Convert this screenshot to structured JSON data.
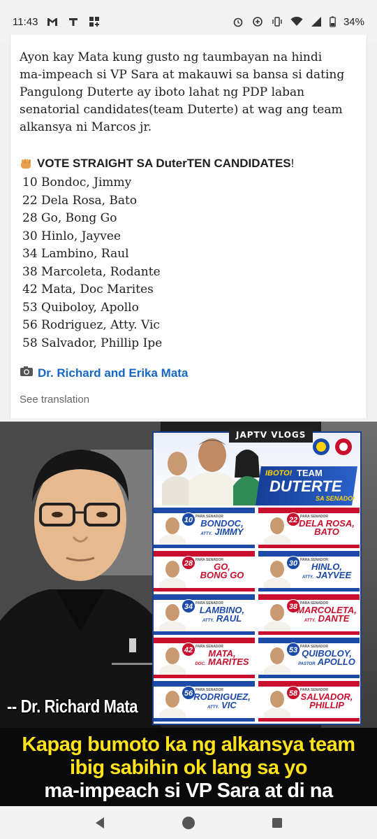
{
  "status_bar": {
    "time": "11:43",
    "battery": "34%",
    "icons": [
      "gmail-icon",
      "tmobile-icon",
      "apps-grid-icon",
      "alarm-icon",
      "data-saver-icon",
      "vibrate-icon",
      "wifi-icon",
      "signal-icon",
      "battery-icon"
    ]
  },
  "post": {
    "intro": "Ayon kay Mata kung gusto ng taumbayan na hindi ma-impeach si VP Sara at makauwi sa bansa si dating Pangulong Duterte ay iboto lahat ng PDP laban senatorial candidates(team Duterte) at wag ang team alkansya ni Marcos jr.",
    "vote_heading": "VOTE STRAIGHT SA DuterTEN CANDIDATES",
    "vote_heading_end": "!",
    "candidates": [
      "10 Bondoc, Jimmy",
      "22 Dela Rosa, Bato",
      "28 Go, Bong Go",
      "30 Hinlo, Jayvee",
      "34 Lambino, Raul",
      "38 Marcoleta, Rodante",
      "42 Mata, Doc Marites",
      "53 Quiboloy, Apollo",
      "56 Rodriguez, Atty. Vic",
      "58 Salvador, Phillip Ipe"
    ],
    "author_link": "Dr. Richard and Erika Mata",
    "see_translation": "See translation"
  },
  "image": {
    "brand": "JAPTV VLOGS",
    "team_iboto": "IBOTO!",
    "team_team": "TEAM",
    "team_duterte": "DUTERTE",
    "team_senado": "SA SENADO!",
    "para_senador": "PARA SENADOR",
    "poster_candidates": [
      {
        "num": "10",
        "line1": "BONDOC,",
        "pre": "ATTY.",
        "line2": "JIMMY",
        "color": "#1b4aa8"
      },
      {
        "num": "22",
        "line1": "DELA ROSA,",
        "pre": "",
        "line2": "BATO",
        "color": "#c8102e"
      },
      {
        "num": "28",
        "line1": "GO,",
        "pre": "",
        "line2": "BONG GO",
        "color": "#c8102e"
      },
      {
        "num": "30",
        "line1": "HINLO,",
        "pre": "ATTY.",
        "line2": "JAYVEE",
        "color": "#1b4aa8"
      },
      {
        "num": "34",
        "line1": "LAMBINO,",
        "pre": "ATTY.",
        "line2": "RAUL",
        "color": "#1b4aa8"
      },
      {
        "num": "38",
        "line1": "MARCOLETA,",
        "pre": "ATTY.",
        "line2": "DANTE",
        "color": "#c8102e"
      },
      {
        "num": "42",
        "line1": "MATA,",
        "pre": "DOC.",
        "line2": "MARITES",
        "color": "#c8102e"
      },
      {
        "num": "53",
        "line1": "QUIBOLOY,",
        "pre": "PASTOR",
        "line2": "APOLLO",
        "color": "#1b4aa8"
      },
      {
        "num": "56",
        "line1": "RODRIGUEZ,",
        "pre": "ATTY.",
        "line2": "VIC",
        "color": "#1b4aa8"
      },
      {
        "num": "58",
        "line1": "SALVADOR,",
        "pre": "",
        "line2": "PHILLIP",
        "color": "#c8102e"
      }
    ],
    "speaker_caption": "-- Dr. Richard Mata",
    "caption_line1": "Kapag bumoto ka ng alkansya team",
    "caption_line2": "ibig sabihin ok lang sa yo",
    "caption_line3": "ma-impeach si VP Sara at di na"
  },
  "nav": {
    "icons": [
      "back-icon",
      "home-icon",
      "recents-icon"
    ]
  }
}
